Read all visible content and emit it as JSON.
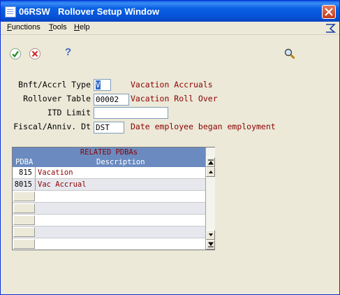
{
  "window": {
    "code": "06RSW",
    "title": "Rollover Setup Window"
  },
  "menu": {
    "items": [
      {
        "label": "Functions",
        "u": "F",
        "rest": "unctions"
      },
      {
        "label": "Tools",
        "u": "T",
        "rest": "ools"
      },
      {
        "label": "Help",
        "u": "H",
        "rest": "elp"
      }
    ]
  },
  "toolbar": {
    "ok": "check-icon",
    "cancel": "cancel-icon",
    "help": "?",
    "search": "search-icon"
  },
  "form": {
    "bnft_type_label": "Bnft/Accrl Type",
    "bnft_type_value": "V",
    "bnft_type_desc": "Vacation Accruals",
    "rollover_label": "Rollover Table",
    "rollover_value": "00002",
    "rollover_desc": "Vacation Roll Over",
    "itd_label": "ITD Limit",
    "itd_value": "",
    "fiscal_label": "Fiscal/Anniv. Dt",
    "fiscal_value": "DST",
    "fiscal_desc": "Date employee began employment"
  },
  "grid": {
    "title": "RELATED PDBAs",
    "col_pdba": "PDBA",
    "col_desc": "Description",
    "rows": [
      {
        "pdba": "815",
        "desc": "Vacation"
      },
      {
        "pdba": "8015",
        "desc": "Vac Accrual"
      }
    ]
  },
  "colors": {
    "title_bar": "#0553d6",
    "grid_header": "#6b8bc0",
    "desc_text": "#8b0000",
    "background": "#ece9d8"
  }
}
